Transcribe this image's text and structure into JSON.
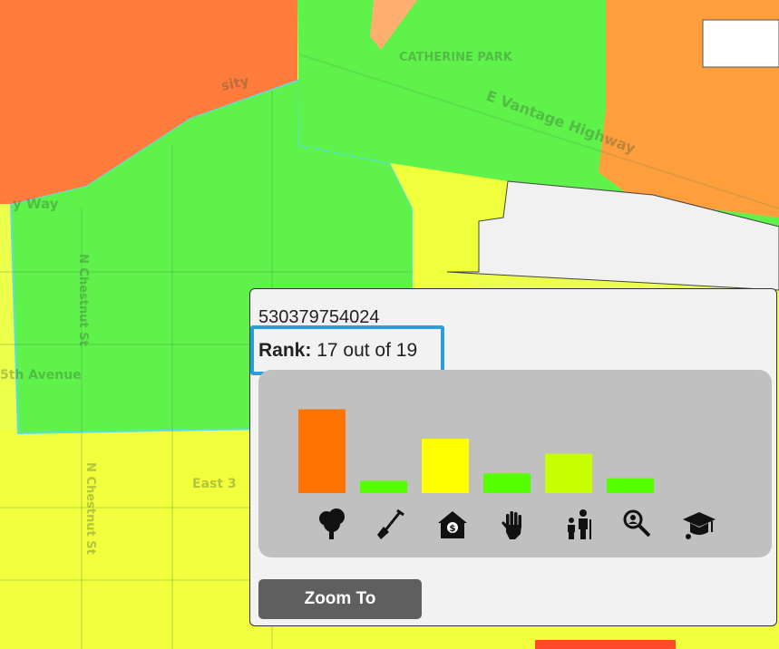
{
  "map": {
    "street_labels": [
      "CATHERINE PARK",
      "E Vantage Highway",
      "N Chestnut St",
      "N Chestnut St",
      "5th Avenue",
      "East 3",
      "y Way",
      "sity"
    ]
  },
  "popup": {
    "tract_id": "530379754024",
    "rank_label": "Rank:",
    "rank_text": "17 out of 19",
    "zoom_button_label": "Zoom To"
  },
  "chart_data": {
    "type": "bar",
    "categories": [
      "tree-icon",
      "shovel-icon",
      "house-money-icon",
      "hand-icon",
      "family-icon",
      "magnifier-icon",
      "graduation-cap-icon"
    ],
    "values": [
      0.68,
      0.1,
      0.44,
      0.16,
      0.32,
      0.12,
      0
    ],
    "colors": [
      "#ff7300",
      "#55ff00",
      "#ffff00",
      "#55ff00",
      "#c8ff00",
      "#55ff00",
      "#55ff00"
    ],
    "ylim": [
      0,
      1
    ]
  }
}
